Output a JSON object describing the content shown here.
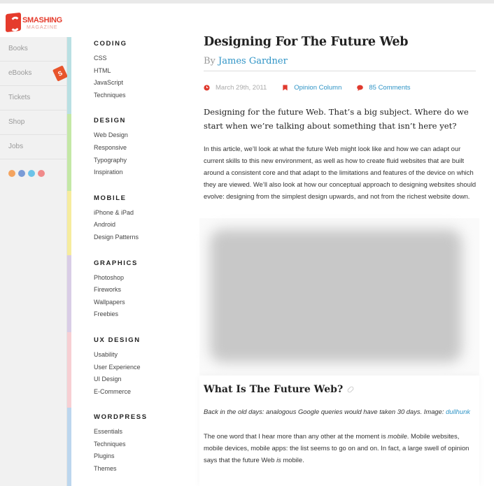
{
  "brand": {
    "name_line1": "SMASHING",
    "name_line2": "MAGAZINE"
  },
  "left_nav": {
    "items": [
      {
        "label": "Books"
      },
      {
        "label": "eBooks"
      },
      {
        "label": "Tickets"
      },
      {
        "label": "Shop"
      },
      {
        "label": "Jobs"
      }
    ],
    "social_icons": [
      "rss-icon",
      "facebook-icon",
      "twitter-icon",
      "newsletter-icon"
    ]
  },
  "categories": [
    {
      "heading": "CODING",
      "color": "#b9e0e3",
      "links": [
        "CSS",
        "HTML",
        "JavaScript",
        "Techniques"
      ]
    },
    {
      "heading": "DESIGN",
      "color": "#c4e8a6",
      "links": [
        "Web Design",
        "Responsive",
        "Typography",
        "Inspiration"
      ]
    },
    {
      "heading": "MOBILE",
      "color": "#f6ec9e",
      "links": [
        "iPhone & iPad",
        "Android",
        "Design Patterns"
      ]
    },
    {
      "heading": "GRAPHICS",
      "color": "#d9cde6",
      "links": [
        "Photoshop",
        "Fireworks",
        "Wallpapers",
        "Freebies"
      ]
    },
    {
      "heading": "UX DESIGN",
      "color": "#f7cfd3",
      "links": [
        "Usability",
        "User Experience",
        "UI Design",
        "E-Commerce"
      ]
    },
    {
      "heading": "WORDPRESS",
      "color": "#bcd6ee",
      "links": [
        "Essentials",
        "Techniques",
        "Plugins",
        "Themes"
      ]
    }
  ],
  "article": {
    "title": "Designing For The Future Web",
    "by": "By",
    "author": "James Gardner",
    "date": "March 29th, 2011",
    "category": "Opinion Column",
    "comments": "85 Comments",
    "lead": "Designing for the future Web. That’s a big subject. Where do we start when we’re talking about something that isn’t here yet?",
    "intro": "In this article, we’ll look at what the future Web might look like and how we can adapt our current skills to this new environment, as well as how to create fluid websites that are built around a consistent core and that adapt to the limitations and features of the device on which they are viewed. We’ll also look at how our conceptual approach to designing websites should evolve: designing from the simplest design upwards, and not from the richest website down.",
    "section_heading": "What Is The Future Web?",
    "caption_text": "Back in the old days: analogous Google queries would have taken 30 days. Image:",
    "caption_link": "dullhunk",
    "para_start": "The one word that I hear more than any other at the moment is ",
    "para_em1": "mobile",
    "para_mid": ". Mobile websites, mobile devices, mobile apps: the list seems to go on and on. In fact, a large swell of opinion says that the future Web ",
    "para_em2": "is",
    "para_end": " mobile."
  },
  "colors": {
    "brand": "#e53b2c",
    "link": "#2f94c6",
    "meta_icon": "#e03a2e"
  }
}
